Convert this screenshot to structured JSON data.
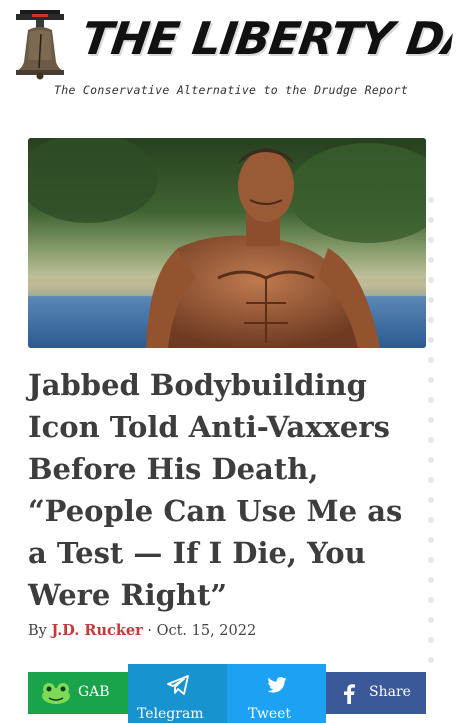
{
  "header": {
    "title": "THE LIBERTY DAILY",
    "tagline": "The Conservative Alternative to the Drudge Report",
    "logo_icon": "liberty-bell-icon"
  },
  "article": {
    "headline": "Jabbed Bodybuilding Icon Told Anti-Vaxxers Before His Death, “People Can Use Me as a Test — If I Die, You Were Right”",
    "byline_prefix": "By",
    "author": "J.D. Rucker",
    "separator": "·",
    "date": "Oct. 15, 2022"
  },
  "share": {
    "gab_label": "GAB",
    "telegram_label": "Telegram",
    "tweet_label": "Tweet",
    "share_label": "Share",
    "colors": {
      "gab": "#19a34a",
      "telegram": "#1793cf",
      "tweet": "#1da1f2",
      "facebook": "#3b5998"
    }
  },
  "colors": {
    "author": "#c33a3a",
    "headline": "#3d3d3d"
  }
}
